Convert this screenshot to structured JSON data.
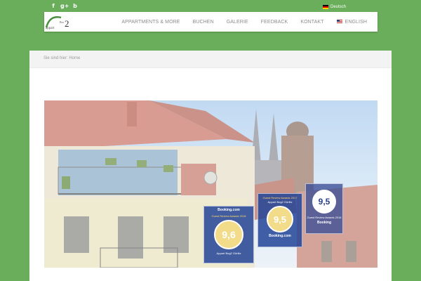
{
  "social": {
    "facebook": "f",
    "googleplus": "g+",
    "blog": "b"
  },
  "lang_top": {
    "label": "Deutsch"
  },
  "nav": {
    "items": [
      "APPARTMENTS & MORE",
      "BUCHEN",
      "GALERIE",
      "FEEDBACK",
      "KONTAKT"
    ],
    "lang": "ENGLISH"
  },
  "logo": {
    "text": "Appart Bog2"
  },
  "breadcrumb": "Sie sind hier: Home",
  "awards": {
    "a1": {
      "brand": "Booking.com",
      "title": "Guest Review Awards 2018",
      "score": "9,6",
      "name": "Appart Bog2 Görlitz"
    },
    "a2": {
      "title": "Guest Review Awards 2017",
      "name": "Appart Bog2 Görlitz",
      "score": "9,5",
      "brand": "Booking.com"
    },
    "a3": {
      "score": "9,5",
      "title": "Guest Review Awards 2016",
      "brand": "Booking"
    }
  },
  "colors": {
    "background": "#6aad5b",
    "header": "#ffffff",
    "nav_text": "#8b8b8b"
  }
}
